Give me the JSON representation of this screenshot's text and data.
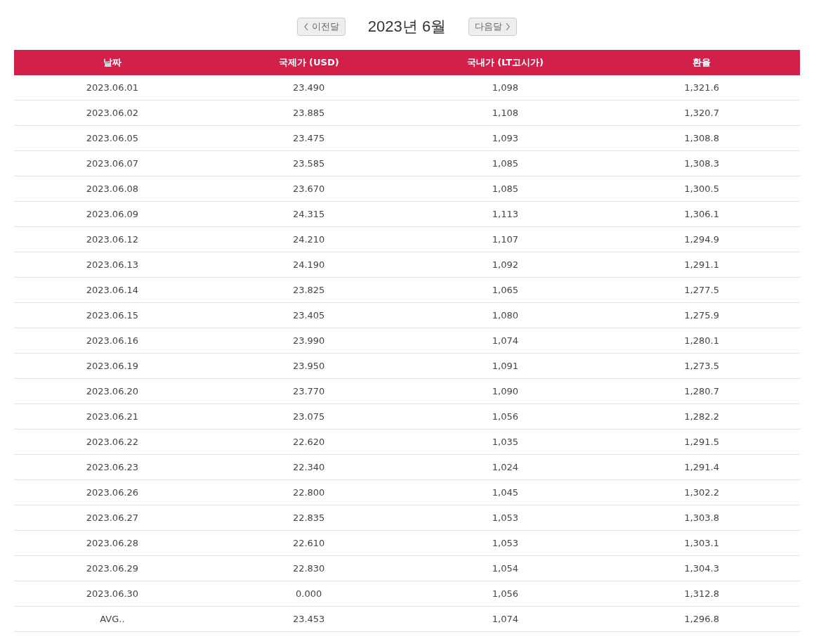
{
  "nav": {
    "prev_button": "이전달",
    "title": "2023년 6월",
    "next_button": "다음달"
  },
  "table": {
    "columns": [
      "날짜",
      "국제가 (USD)",
      "국내가 (LT고시가)",
      "환율"
    ],
    "rows": [
      [
        "2023.06.01",
        "23.490",
        "1,098",
        "1,321.6"
      ],
      [
        "2023.06.02",
        "23.885",
        "1,108",
        "1,320.7"
      ],
      [
        "2023.06.05",
        "23.475",
        "1,093",
        "1,308.8"
      ],
      [
        "2023.06.07",
        "23.585",
        "1,085",
        "1,308.3"
      ],
      [
        "2023.06.08",
        "23.670",
        "1,085",
        "1,300.5"
      ],
      [
        "2023.06.09",
        "24.315",
        "1,113",
        "1,306.1"
      ],
      [
        "2023.06.12",
        "24.210",
        "1,107",
        "1,294.9"
      ],
      [
        "2023.06.13",
        "24.190",
        "1,092",
        "1,291.1"
      ],
      [
        "2023.06.14",
        "23.825",
        "1,065",
        "1,277.5"
      ],
      [
        "2023.06.15",
        "23.405",
        "1,080",
        "1,275.9"
      ],
      [
        "2023.06.16",
        "23.990",
        "1,074",
        "1,280.1"
      ],
      [
        "2023.06.19",
        "23.950",
        "1,091",
        "1,273.5"
      ],
      [
        "2023.06.20",
        "23.770",
        "1,090",
        "1,280.7"
      ],
      [
        "2023.06.21",
        "23.075",
        "1,056",
        "1,282.2"
      ],
      [
        "2023.06.22",
        "22.620",
        "1,035",
        "1,291.5"
      ],
      [
        "2023.06.23",
        "22.340",
        "1,024",
        "1,291.4"
      ],
      [
        "2023.06.26",
        "22.800",
        "1,045",
        "1,302.2"
      ],
      [
        "2023.06.27",
        "22.835",
        "1,053",
        "1,303.8"
      ],
      [
        "2023.06.28",
        "22.610",
        "1,053",
        "1,303.1"
      ],
      [
        "2023.06.29",
        "22.830",
        "1,054",
        "1,304.3"
      ],
      [
        "2023.06.30",
        "0.000",
        "1,056",
        "1,312.8"
      ],
      [
        "AVG..",
        "23.453",
        "1,074",
        "1,296.8"
      ]
    ]
  }
}
